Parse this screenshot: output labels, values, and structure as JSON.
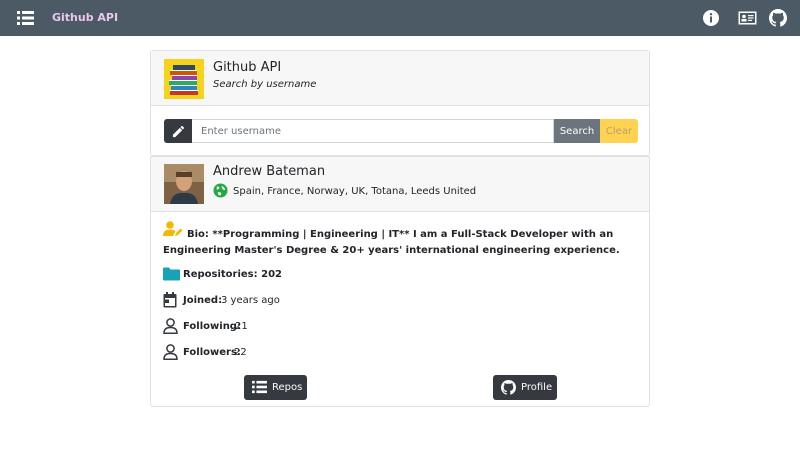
{
  "navbar": {
    "brand": "Github API",
    "icons": [
      "list-icon",
      "info-icon",
      "id-card-icon",
      "github-icon"
    ]
  },
  "header": {
    "title": "Github API",
    "subtitle": "Search by username",
    "logo_icon": "books-icon"
  },
  "search": {
    "placeholder": "Enter username",
    "value": "",
    "search_label": "Search",
    "clear_label": "Clear",
    "icon": "pencil-icon"
  },
  "profile": {
    "name": "Andrew Bateman",
    "location": "Spain, France, Norway, UK, Totana, Leeds United",
    "bio": "Bio: **Programming | Engineering | IT** I am a Full-Stack Developer with an Engineering Master's Degree & 20+ years' international engineering experience.",
    "repositories": "Repositories: 202",
    "joined_label": "Joined:",
    "joined_value": "3 years ago",
    "following_label": "Following:",
    "following_value": "21",
    "followers_label": "Followers:",
    "followers_value": "22",
    "repos_button": "Repos",
    "profile_button": "Profile"
  },
  "colors": {
    "navbar": "#4b5a65",
    "brand": "#e9c6ef",
    "dark_button": "#343a40",
    "search_button": "#6c757d",
    "clear_button": "#ffd351",
    "folder_icon": "#17a2b8",
    "bio_icon": "#f5b800",
    "globe_icon": "#28a745"
  }
}
